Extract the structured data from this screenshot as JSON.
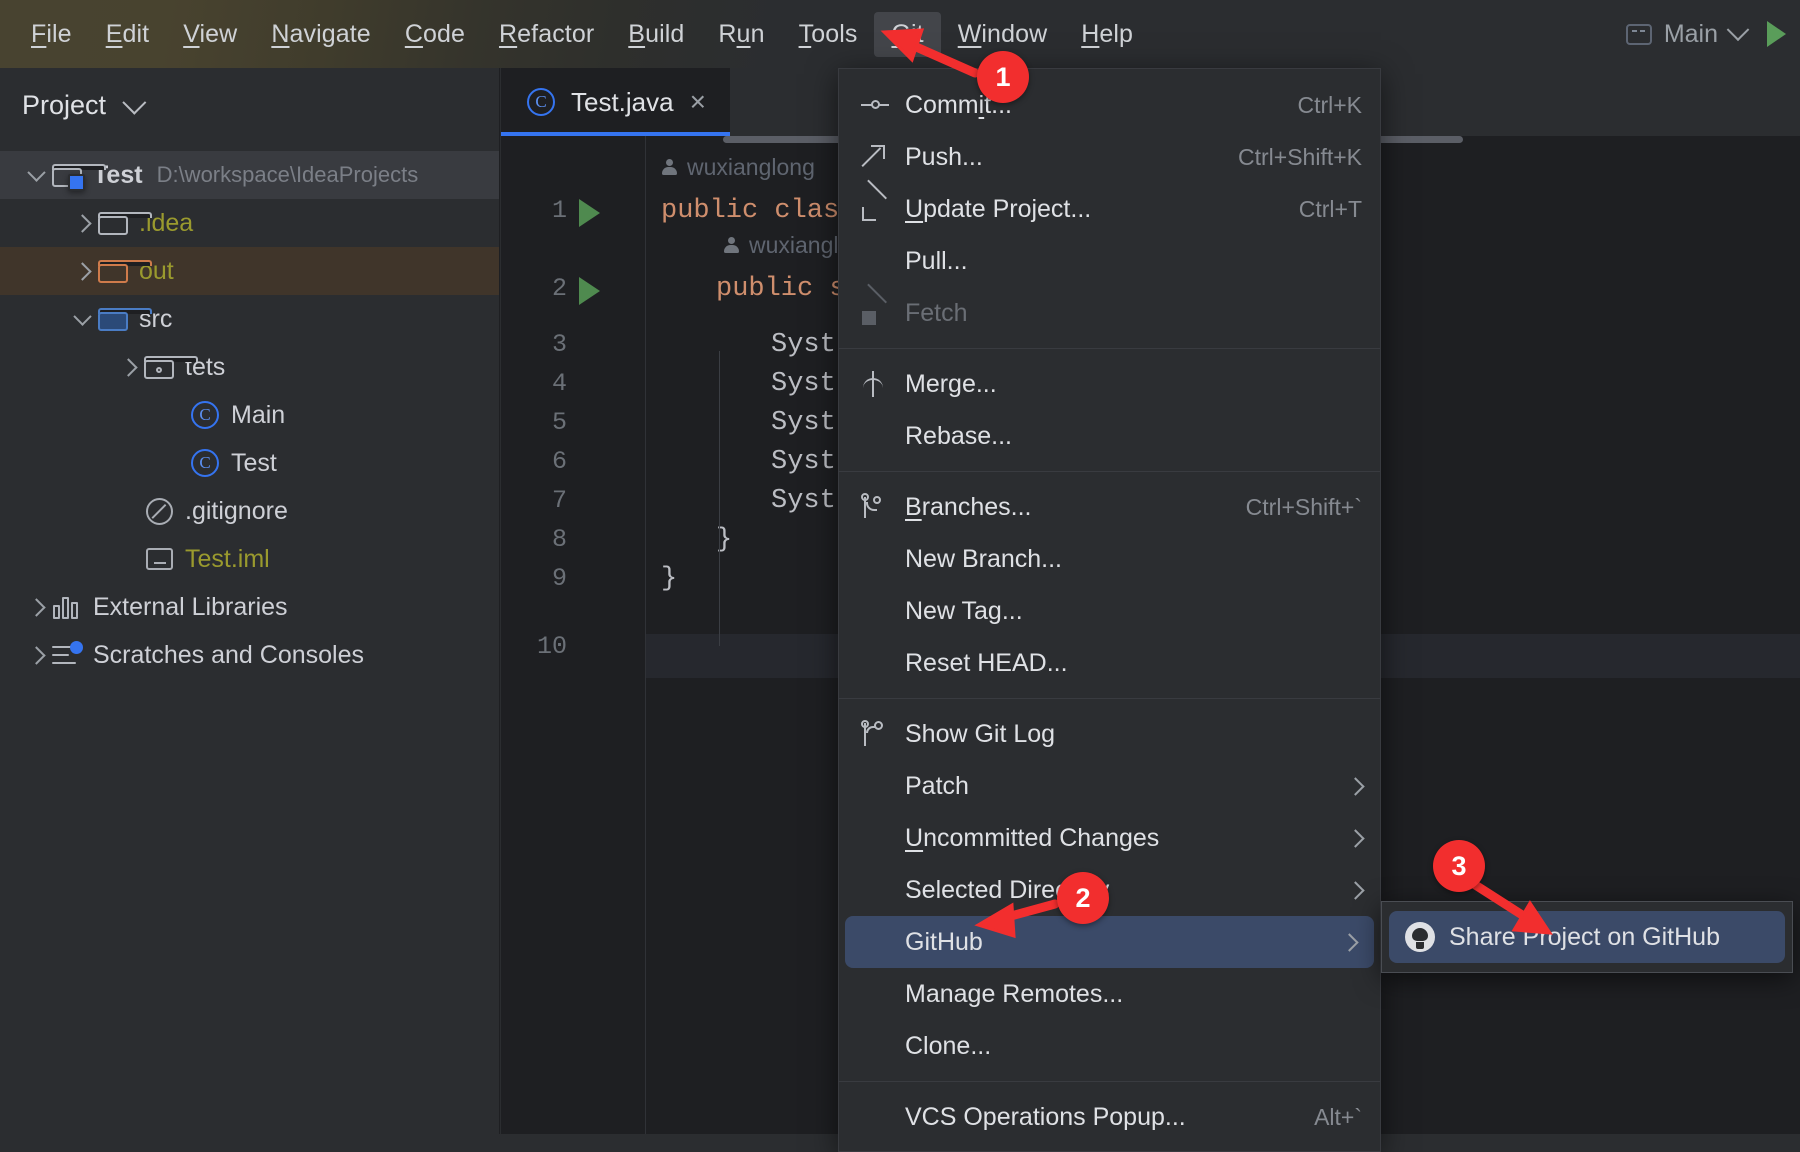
{
  "menubar": {
    "items": [
      {
        "label": "File",
        "mnemonic": "F",
        "active": false
      },
      {
        "label": "Edit",
        "mnemonic": "E",
        "active": false
      },
      {
        "label": "View",
        "mnemonic": "V",
        "active": false
      },
      {
        "label": "Navigate",
        "mnemonic": "N",
        "active": false
      },
      {
        "label": "Code",
        "mnemonic": "C",
        "active": false
      },
      {
        "label": "Refactor",
        "mnemonic": "R",
        "active": false
      },
      {
        "label": "Build",
        "mnemonic": "B",
        "active": false
      },
      {
        "label": "Run",
        "mnemonic": "u",
        "active": false
      },
      {
        "label": "Tools",
        "mnemonic": "T",
        "active": false
      },
      {
        "label": "Git",
        "mnemonic": "G",
        "active": true
      },
      {
        "label": "Window",
        "mnemonic": "W",
        "active": false
      },
      {
        "label": "Help",
        "mnemonic": "H",
        "active": false
      }
    ],
    "run_config": {
      "label": "Main",
      "icon": "run-config-icon",
      "chevron": "chevron-down-icon",
      "run": "run-icon"
    }
  },
  "project_panel": {
    "title": "Project",
    "tree": [
      {
        "label": "Test",
        "path": "D:\\workspace\\IdeaProjects",
        "icon": "module-folder-icon",
        "depth": 0,
        "arrow": "open",
        "selected": "project",
        "color": "white",
        "bold": true
      },
      {
        "label": ".idea",
        "path": "",
        "icon": "folder-icon",
        "depth": 1,
        "arrow": "closed",
        "selected": "",
        "color": "olive"
      },
      {
        "label": "out",
        "path": "",
        "icon": "folder-orange-icon",
        "depth": 1,
        "arrow": "closed",
        "selected": "out",
        "color": "olive"
      },
      {
        "label": "src",
        "path": "",
        "icon": "folder-source-icon",
        "depth": 1,
        "arrow": "open",
        "selected": "",
        "color": "white"
      },
      {
        "label": "tets",
        "path": "",
        "icon": "package-folder-icon",
        "depth": 2,
        "arrow": "closed",
        "selected": "",
        "color": "white"
      },
      {
        "label": "Main",
        "path": "",
        "icon": "java-class-icon",
        "depth": 3,
        "arrow": "none",
        "selected": "",
        "color": "white"
      },
      {
        "label": "Test",
        "path": "",
        "icon": "java-class-icon",
        "depth": 3,
        "arrow": "none",
        "selected": "",
        "color": "white"
      },
      {
        "label": ".gitignore",
        "path": "",
        "icon": "gitignore-icon",
        "depth": 2,
        "arrow": "none",
        "selected": "",
        "color": "white"
      },
      {
        "label": "Test.iml",
        "path": "",
        "icon": "iml-file-icon",
        "depth": 2,
        "arrow": "none",
        "selected": "",
        "color": "olive"
      },
      {
        "label": "External Libraries",
        "path": "",
        "icon": "libraries-icon",
        "depth": 0,
        "arrow": "closed",
        "selected": "",
        "color": "white"
      },
      {
        "label": "Scratches and Consoles",
        "path": "",
        "icon": "scratches-icon",
        "depth": 0,
        "arrow": "closed",
        "selected": "",
        "color": "white"
      }
    ]
  },
  "editor": {
    "tab": {
      "label": "Test.java",
      "icon": "java-class-icon",
      "close": "×"
    },
    "gutter_lines": [
      "1",
      "2",
      "3",
      "4",
      "5",
      "6",
      "7",
      "8",
      "9",
      "10"
    ],
    "caret_line": 10,
    "run_markers": [
      1,
      2
    ],
    "annotations": [
      {
        "author": "wuxianglong",
        "line": 1
      },
      {
        "author": "wuxianglong",
        "line": 2
      }
    ],
    "code_lines": [
      {
        "line": 1,
        "text": "public class",
        "kind": "keyword-head"
      },
      {
        "line": 2,
        "text": "public s",
        "kind": "keyword-head"
      },
      {
        "line": 3,
        "text": "Syst",
        "kind": "plain"
      },
      {
        "line": 4,
        "text": "Syst",
        "kind": "plain"
      },
      {
        "line": 5,
        "text": "Syst",
        "kind": "plain"
      },
      {
        "line": 6,
        "text": "Syst",
        "kind": "plain"
      },
      {
        "line": 7,
        "text": "Syst",
        "kind": "plain"
      },
      {
        "line": 8,
        "text": "}",
        "kind": "plain"
      },
      {
        "line": 9,
        "text": "}",
        "kind": "plain"
      },
      {
        "line": 10,
        "text": "",
        "kind": "plain"
      }
    ]
  },
  "git_menu": {
    "items": [
      {
        "label": "Commit...",
        "mnemonic": "i",
        "shortcut": "Ctrl+K",
        "icon": "commit-icon",
        "type": "item"
      },
      {
        "label": "Push...",
        "mnemonic": "",
        "shortcut": "Ctrl+Shift+K",
        "icon": "push-icon",
        "type": "item"
      },
      {
        "label": "Update Project...",
        "mnemonic": "U",
        "shortcut": "Ctrl+T",
        "icon": "update-project-icon",
        "type": "item"
      },
      {
        "label": "Pull...",
        "mnemonic": "",
        "shortcut": "",
        "icon": "",
        "type": "item"
      },
      {
        "label": "Fetch",
        "mnemonic": "",
        "shortcut": "",
        "icon": "fetch-icon",
        "type": "item",
        "disabled": true
      },
      {
        "type": "separator"
      },
      {
        "label": "Merge...",
        "mnemonic": "",
        "shortcut": "",
        "icon": "merge-icon",
        "type": "item"
      },
      {
        "label": "Rebase...",
        "mnemonic": "",
        "shortcut": "",
        "icon": "",
        "type": "item"
      },
      {
        "type": "separator"
      },
      {
        "label": "Branches...",
        "mnemonic": "B",
        "shortcut": "Ctrl+Shift+`",
        "icon": "branches-icon",
        "type": "item"
      },
      {
        "label": "New Branch...",
        "mnemonic": "",
        "shortcut": "",
        "icon": "",
        "type": "item"
      },
      {
        "label": "New Tag...",
        "mnemonic": "",
        "shortcut": "",
        "icon": "",
        "type": "item"
      },
      {
        "label": "Reset HEAD...",
        "mnemonic": "",
        "shortcut": "",
        "icon": "",
        "type": "item"
      },
      {
        "type": "separator"
      },
      {
        "label": "Show Git Log",
        "mnemonic": "",
        "shortcut": "",
        "icon": "git-log-icon",
        "type": "item"
      },
      {
        "label": "Patch",
        "mnemonic": "",
        "shortcut": "",
        "icon": "",
        "type": "submenu"
      },
      {
        "label": "Uncommitted Changes",
        "mnemonic": "U",
        "shortcut": "",
        "icon": "",
        "type": "submenu"
      },
      {
        "label": "Selected Directory",
        "mnemonic": "",
        "shortcut": "",
        "icon": "",
        "type": "submenu"
      },
      {
        "label": "GitHub",
        "mnemonic": "",
        "shortcut": "",
        "icon": "",
        "type": "submenu",
        "selected": true
      },
      {
        "label": "Manage Remotes...",
        "mnemonic": "",
        "shortcut": "",
        "icon": "",
        "type": "item"
      },
      {
        "label": "Clone...",
        "mnemonic": "",
        "shortcut": "",
        "icon": "",
        "type": "item"
      },
      {
        "type": "separator"
      },
      {
        "label": "VCS Operations Popup...",
        "mnemonic": "",
        "shortcut": "Alt+`",
        "icon": "",
        "type": "item"
      }
    ]
  },
  "github_submenu": {
    "items": [
      {
        "label": "Share Project on GitHub",
        "icon": "github-icon",
        "selected": true
      }
    ]
  },
  "callouts": [
    {
      "number": "1",
      "target": "git-menu-label"
    },
    {
      "number": "2",
      "target": "github-menu-item"
    },
    {
      "number": "3",
      "target": "share-project-on-github-item"
    }
  ],
  "colors": {
    "accent_blue": "#3574f0",
    "selection_blue": "#3b4a68",
    "callout_red": "#f22e2e",
    "menu_bg": "#2b2d30",
    "editor_bg": "#1e1f22",
    "out_highlight": "#40352a"
  }
}
